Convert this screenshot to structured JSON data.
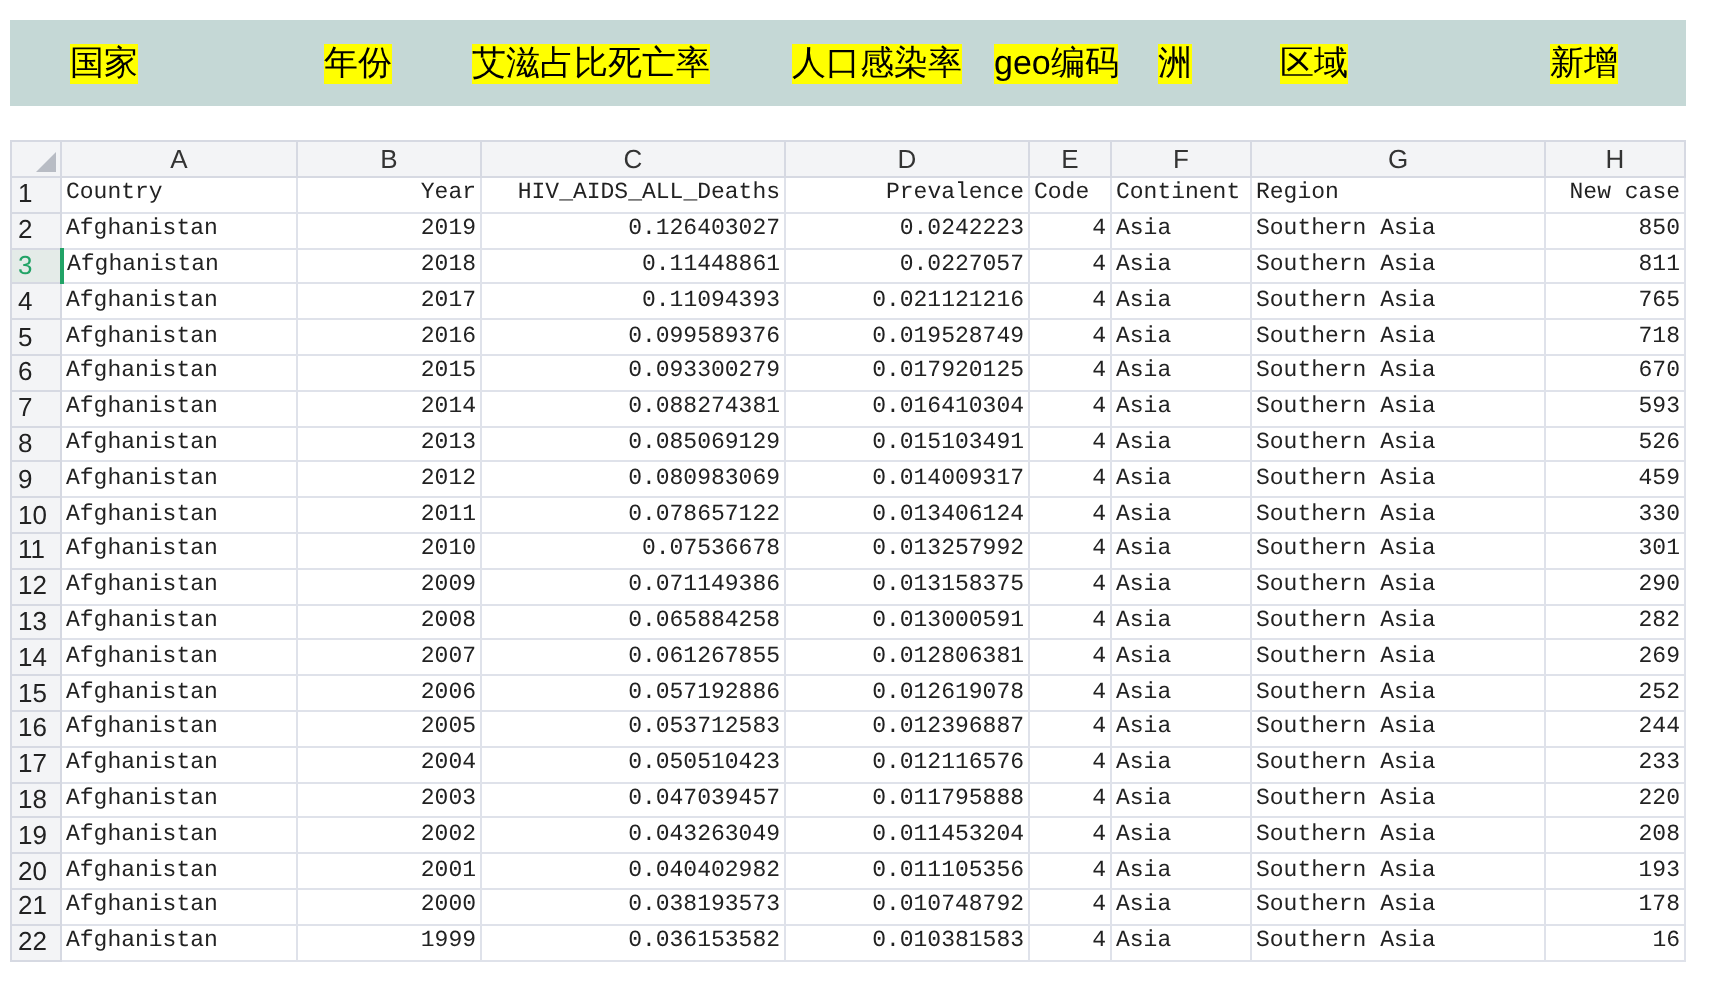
{
  "labels": [
    "国家",
    "年份",
    "艾滋占比死亡率",
    "人口感染率",
    "geo编码",
    "洲",
    "区域",
    "新增"
  ],
  "sheet": {
    "columns": [
      "A",
      "B",
      "C",
      "D",
      "E",
      "F",
      "G",
      "H"
    ],
    "rows": [
      {
        "number": "1",
        "selected": false,
        "cells": [
          "Country",
          "Year",
          "HIV_AIDS_ALL_Deaths",
          "Prevalence",
          "Code",
          "Continent",
          "Region",
          "New case"
        ]
      },
      {
        "number": "2",
        "selected": false,
        "cells": [
          "Afghanistan",
          "2019",
          "0.126403027",
          "0.0242223",
          "4",
          "Asia",
          "Southern Asia",
          "850"
        ]
      },
      {
        "number": "3",
        "selected": true,
        "cells": [
          "Afghanistan",
          "2018",
          "0.11448861",
          "0.0227057",
          "4",
          "Asia",
          "Southern Asia",
          "811"
        ]
      },
      {
        "number": "4",
        "selected": false,
        "cells": [
          "Afghanistan",
          "2017",
          "0.11094393",
          "0.021121216",
          "4",
          "Asia",
          "Southern Asia",
          "765"
        ]
      },
      {
        "number": "5",
        "selected": false,
        "cells": [
          "Afghanistan",
          "2016",
          "0.099589376",
          "0.019528749",
          "4",
          "Asia",
          "Southern Asia",
          "718"
        ]
      },
      {
        "number": "6",
        "selected": false,
        "cells": [
          "Afghanistan",
          "2015",
          "0.093300279",
          "0.017920125",
          "4",
          "Asia",
          "Southern Asia",
          "670"
        ]
      },
      {
        "number": "7",
        "selected": false,
        "cells": [
          "Afghanistan",
          "2014",
          "0.088274381",
          "0.016410304",
          "4",
          "Asia",
          "Southern Asia",
          "593"
        ]
      },
      {
        "number": "8",
        "selected": false,
        "cells": [
          "Afghanistan",
          "2013",
          "0.085069129",
          "0.015103491",
          "4",
          "Asia",
          "Southern Asia",
          "526"
        ]
      },
      {
        "number": "9",
        "selected": false,
        "cells": [
          "Afghanistan",
          "2012",
          "0.080983069",
          "0.014009317",
          "4",
          "Asia",
          "Southern Asia",
          "459"
        ]
      },
      {
        "number": "10",
        "selected": false,
        "cells": [
          "Afghanistan",
          "2011",
          "0.078657122",
          "0.013406124",
          "4",
          "Asia",
          "Southern Asia",
          "330"
        ]
      },
      {
        "number": "11",
        "selected": false,
        "cells": [
          "Afghanistan",
          "2010",
          "0.07536678",
          "0.013257992",
          "4",
          "Asia",
          "Southern Asia",
          "301"
        ]
      },
      {
        "number": "12",
        "selected": false,
        "cells": [
          "Afghanistan",
          "2009",
          "0.071149386",
          "0.013158375",
          "4",
          "Asia",
          "Southern Asia",
          "290"
        ]
      },
      {
        "number": "13",
        "selected": false,
        "cells": [
          "Afghanistan",
          "2008",
          "0.065884258",
          "0.013000591",
          "4",
          "Asia",
          "Southern Asia",
          "282"
        ]
      },
      {
        "number": "14",
        "selected": false,
        "cells": [
          "Afghanistan",
          "2007",
          "0.061267855",
          "0.012806381",
          "4",
          "Asia",
          "Southern Asia",
          "269"
        ]
      },
      {
        "number": "15",
        "selected": false,
        "cells": [
          "Afghanistan",
          "2006",
          "0.057192886",
          "0.012619078",
          "4",
          "Asia",
          "Southern Asia",
          "252"
        ]
      },
      {
        "number": "16",
        "selected": false,
        "cells": [
          "Afghanistan",
          "2005",
          "0.053712583",
          "0.012396887",
          "4",
          "Asia",
          "Southern Asia",
          "244"
        ]
      },
      {
        "number": "17",
        "selected": false,
        "cells": [
          "Afghanistan",
          "2004",
          "0.050510423",
          "0.012116576",
          "4",
          "Asia",
          "Southern Asia",
          "233"
        ]
      },
      {
        "number": "18",
        "selected": false,
        "cells": [
          "Afghanistan",
          "2003",
          "0.047039457",
          "0.011795888",
          "4",
          "Asia",
          "Southern Asia",
          "220"
        ]
      },
      {
        "number": "19",
        "selected": false,
        "cells": [
          "Afghanistan",
          "2002",
          "0.043263049",
          "0.011453204",
          "4",
          "Asia",
          "Southern Asia",
          "208"
        ]
      },
      {
        "number": "20",
        "selected": false,
        "cells": [
          "Afghanistan",
          "2001",
          "0.040402982",
          "0.011105356",
          "4",
          "Asia",
          "Southern Asia",
          "193"
        ]
      },
      {
        "number": "21",
        "selected": false,
        "cells": [
          "Afghanistan",
          "2000",
          "0.038193573",
          "0.010748792",
          "4",
          "Asia",
          "Southern Asia",
          "178"
        ]
      },
      {
        "number": "22",
        "selected": false,
        "cells": [
          "Afghanistan",
          "1999",
          "0.036153582",
          "0.010381583",
          "4",
          "Asia",
          "Southern Asia",
          "16"
        ]
      }
    ]
  }
}
